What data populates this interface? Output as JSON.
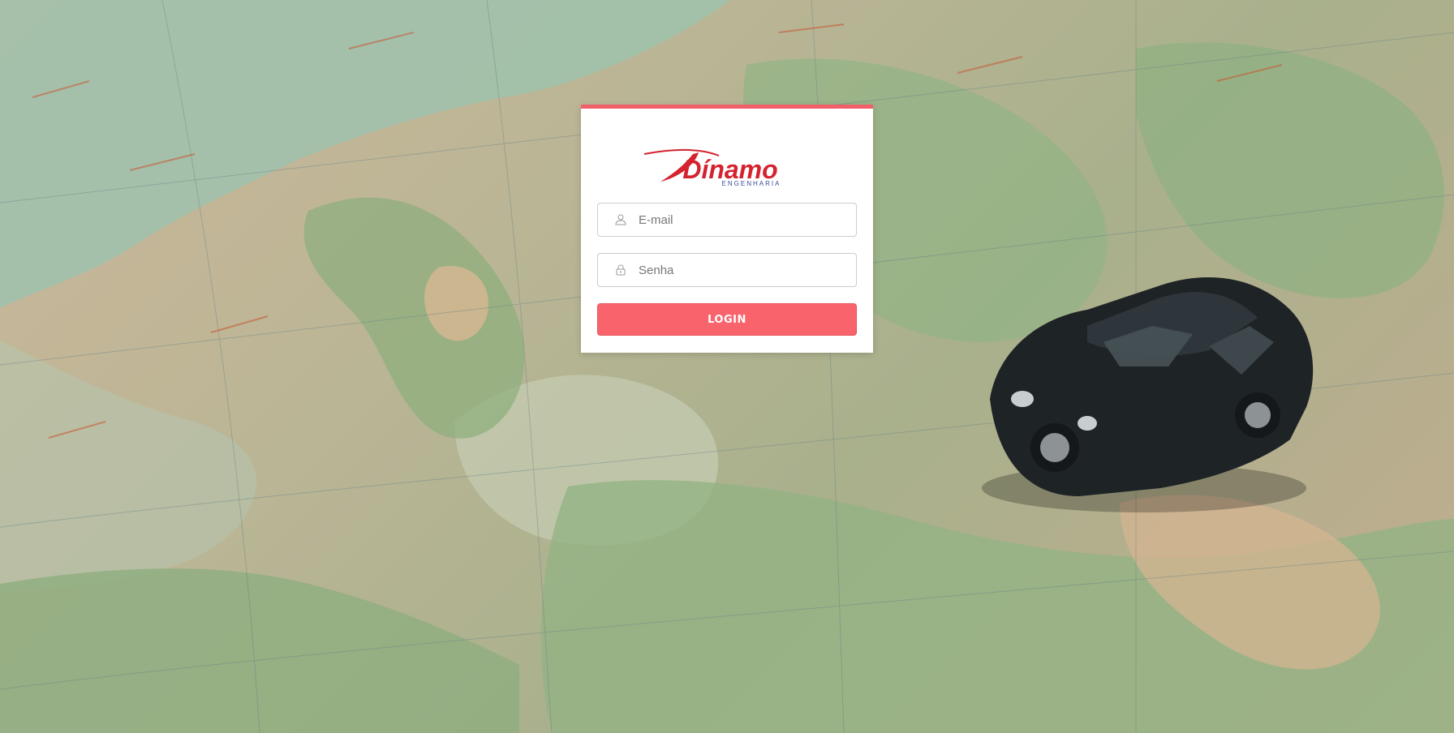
{
  "brand": {
    "logo_text": "Dínamo",
    "logo_subtext": "ENGENHARIA",
    "accent_color": "#f8636c"
  },
  "login": {
    "email_placeholder": "E-mail",
    "password_placeholder": "Senha",
    "submit_label": "LOGIN"
  },
  "icons": {
    "email": "user-icon",
    "password": "lock-icon"
  },
  "background": {
    "description_name": "map-background"
  }
}
